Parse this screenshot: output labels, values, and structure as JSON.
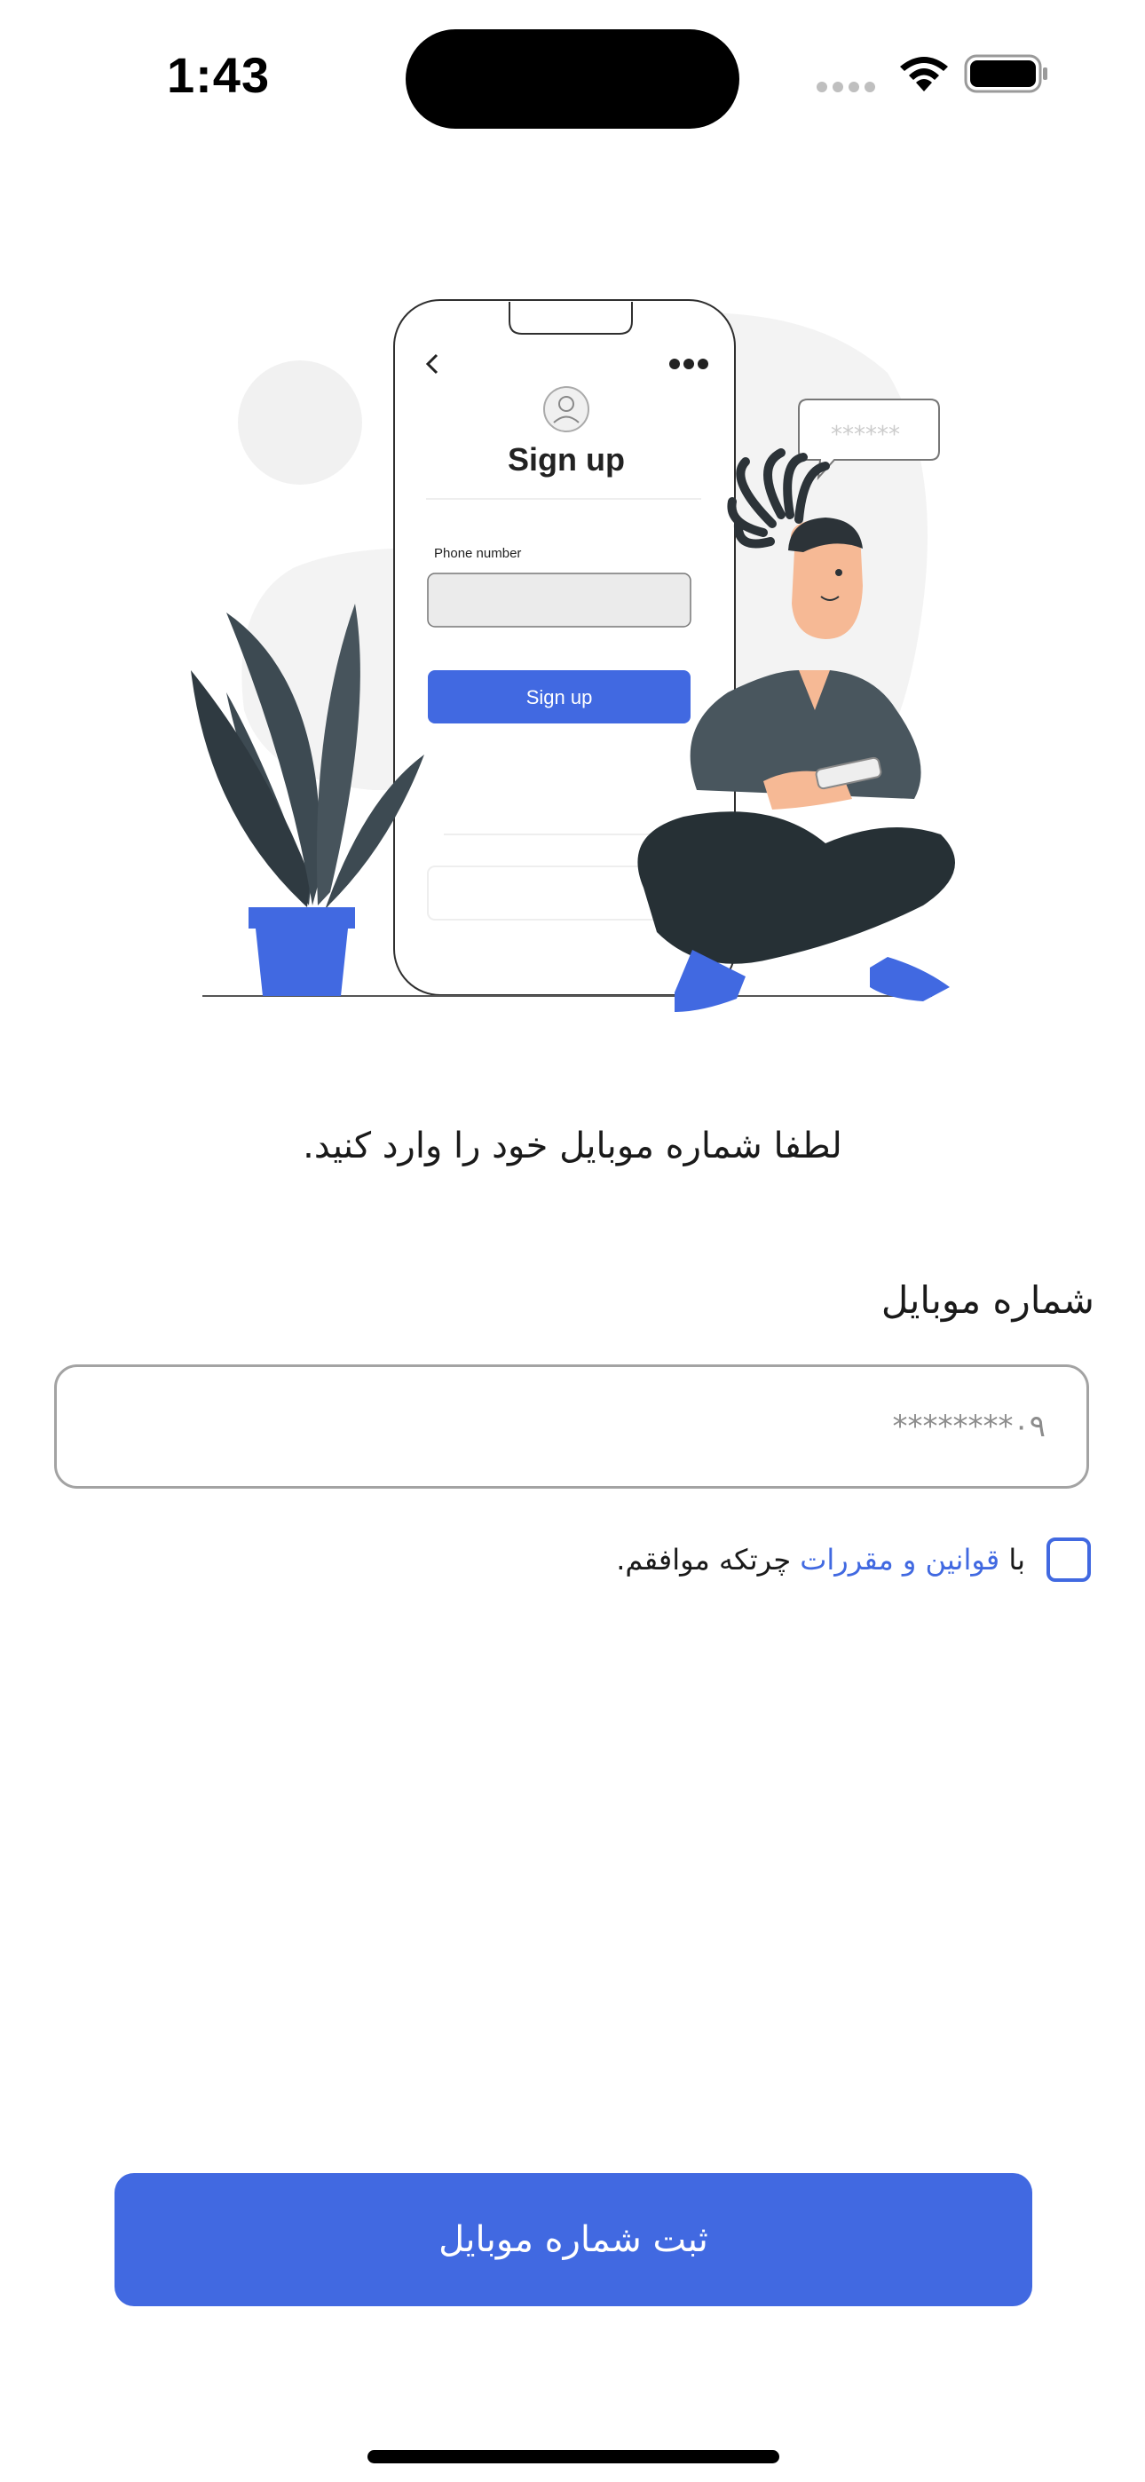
{
  "status_bar": {
    "time": "1:43",
    "battery_level": 1.0
  },
  "illustration": {
    "mockup_title": "Sign up",
    "mockup_field_label": "Phone number",
    "mockup_button_label": "Sign up",
    "speech_bubble_text": "******"
  },
  "page": {
    "instruction": "لطفا شماره موبایل خود را وارد کنید.",
    "phone_label": "شماره موبایل",
    "phone_placeholder": "۰۹********",
    "terms_prefix": "با ",
    "terms_link": "قوانین و مقررات",
    "terms_suffix": " چرتکه موافقم.",
    "submit_label": "ثبت شماره موبایل"
  },
  "colors": {
    "accent": "#4169e1",
    "plant": "#3d4a52",
    "text": "#1a1a1a"
  },
  "icons": [
    "wifi-icon",
    "battery-icon",
    "signal-dots-icon",
    "back-chevron-icon",
    "more-dots-icon",
    "avatar-icon"
  ]
}
